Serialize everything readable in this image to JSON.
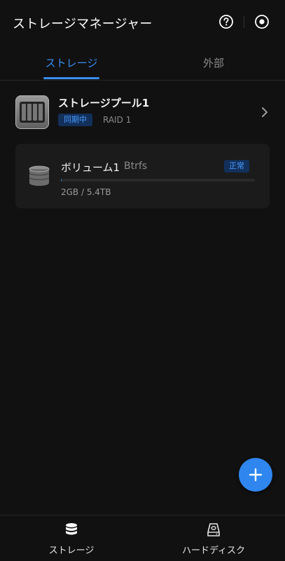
{
  "header": {
    "title": "ストレージマネージャー",
    "help_icon": "help-circle-icon",
    "more_icon": "target-icon"
  },
  "tabs": [
    {
      "label": "ストレージ",
      "active": true
    },
    {
      "label": "外部",
      "active": false
    }
  ],
  "pool": {
    "name": "ストレージプール1",
    "status": "同期中",
    "raid": "RAID 1",
    "icon": "nas-drive-icon"
  },
  "volume": {
    "name": "ボリューム1",
    "filesystem": "Btrfs",
    "status": "正常",
    "usage": "2GB / 5.4TB",
    "usage_fraction": 0.0004,
    "icon": "database-icon"
  },
  "fab": {
    "icon": "plus-icon"
  },
  "bottom_nav": [
    {
      "label": "ストレージ",
      "icon": "database-icon"
    },
    {
      "label": "ハードディスク",
      "icon": "hard-disk-icon"
    }
  ],
  "colors": {
    "accent": "#3a8ef0",
    "background": "#111111",
    "card": "#1b1b1b",
    "badge_bg": "#12305a",
    "badge_text": "#4a9bff"
  }
}
